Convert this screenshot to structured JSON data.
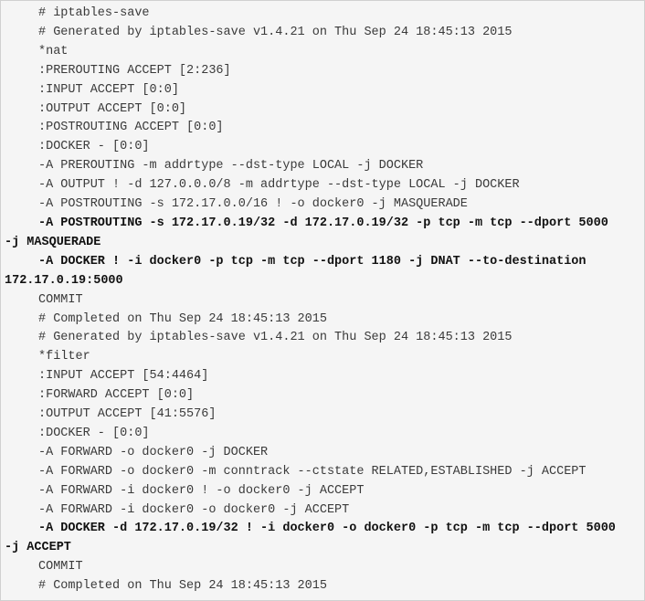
{
  "document": {
    "lines": [
      {
        "text": "# iptables-save",
        "bold": false,
        "indent": true
      },
      {
        "text": "# Generated by iptables-save v1.4.21 on Thu Sep 24 18:45:13 2015",
        "bold": false,
        "indent": true
      },
      {
        "text": "*nat",
        "bold": false,
        "indent": true
      },
      {
        "text": ":PREROUTING ACCEPT [2:236]",
        "bold": false,
        "indent": true
      },
      {
        "text": ":INPUT ACCEPT [0:0]",
        "bold": false,
        "indent": true
      },
      {
        "text": ":OUTPUT ACCEPT [0:0]",
        "bold": false,
        "indent": true
      },
      {
        "text": ":POSTROUTING ACCEPT [0:0]",
        "bold": false,
        "indent": true
      },
      {
        "text": ":DOCKER - [0:0]",
        "bold": false,
        "indent": true
      },
      {
        "text": "-A PREROUTING -m addrtype --dst-type LOCAL -j DOCKER",
        "bold": false,
        "indent": true
      },
      {
        "text": "-A OUTPUT ! -d 127.0.0.0/8 -m addrtype --dst-type LOCAL -j DOCKER",
        "bold": false,
        "indent": true
      },
      {
        "text": "-A POSTROUTING -s 172.17.0.0/16 ! -o docker0 -j MASQUERADE",
        "bold": false,
        "indent": true
      },
      {
        "text": "-A POSTROUTING -s 172.17.0.19/32 -d 172.17.0.19/32 -p tcp -m tcp --dport 5000",
        "bold": true,
        "indent": true
      },
      {
        "text": "-j MASQUERADE",
        "bold": true,
        "indent": false
      },
      {
        "text": "-A DOCKER ! -i docker0 -p tcp -m tcp --dport 1180 -j DNAT --to-destination",
        "bold": true,
        "indent": true
      },
      {
        "text": "172.17.0.19:5000",
        "bold": true,
        "indent": false
      },
      {
        "text": "COMMIT",
        "bold": false,
        "indent": true
      },
      {
        "text": "# Completed on Thu Sep 24 18:45:13 2015",
        "bold": false,
        "indent": true
      },
      {
        "text": "# Generated by iptables-save v1.4.21 on Thu Sep 24 18:45:13 2015",
        "bold": false,
        "indent": true
      },
      {
        "text": "*filter",
        "bold": false,
        "indent": true
      },
      {
        "text": ":INPUT ACCEPT [54:4464]",
        "bold": false,
        "indent": true
      },
      {
        "text": ":FORWARD ACCEPT [0:0]",
        "bold": false,
        "indent": true
      },
      {
        "text": ":OUTPUT ACCEPT [41:5576]",
        "bold": false,
        "indent": true
      },
      {
        "text": ":DOCKER - [0:0]",
        "bold": false,
        "indent": true
      },
      {
        "text": "-A FORWARD -o docker0 -j DOCKER",
        "bold": false,
        "indent": true
      },
      {
        "text": "-A FORWARD -o docker0 -m conntrack --ctstate RELATED,ESTABLISHED -j ACCEPT",
        "bold": false,
        "indent": true
      },
      {
        "text": "-A FORWARD -i docker0 ! -o docker0 -j ACCEPT",
        "bold": false,
        "indent": true
      },
      {
        "text": "-A FORWARD -i docker0 -o docker0 -j ACCEPT",
        "bold": false,
        "indent": true
      },
      {
        "text": "-A DOCKER -d 172.17.0.19/32 ! -i docker0 -o docker0 -p tcp -m tcp --dport 5000",
        "bold": true,
        "indent": true
      },
      {
        "text": "-j ACCEPT",
        "bold": true,
        "indent": false
      },
      {
        "text": "COMMIT",
        "bold": false,
        "indent": true
      },
      {
        "text": "# Completed on Thu Sep 24 18:45:13 2015",
        "bold": false,
        "indent": true
      }
    ]
  }
}
